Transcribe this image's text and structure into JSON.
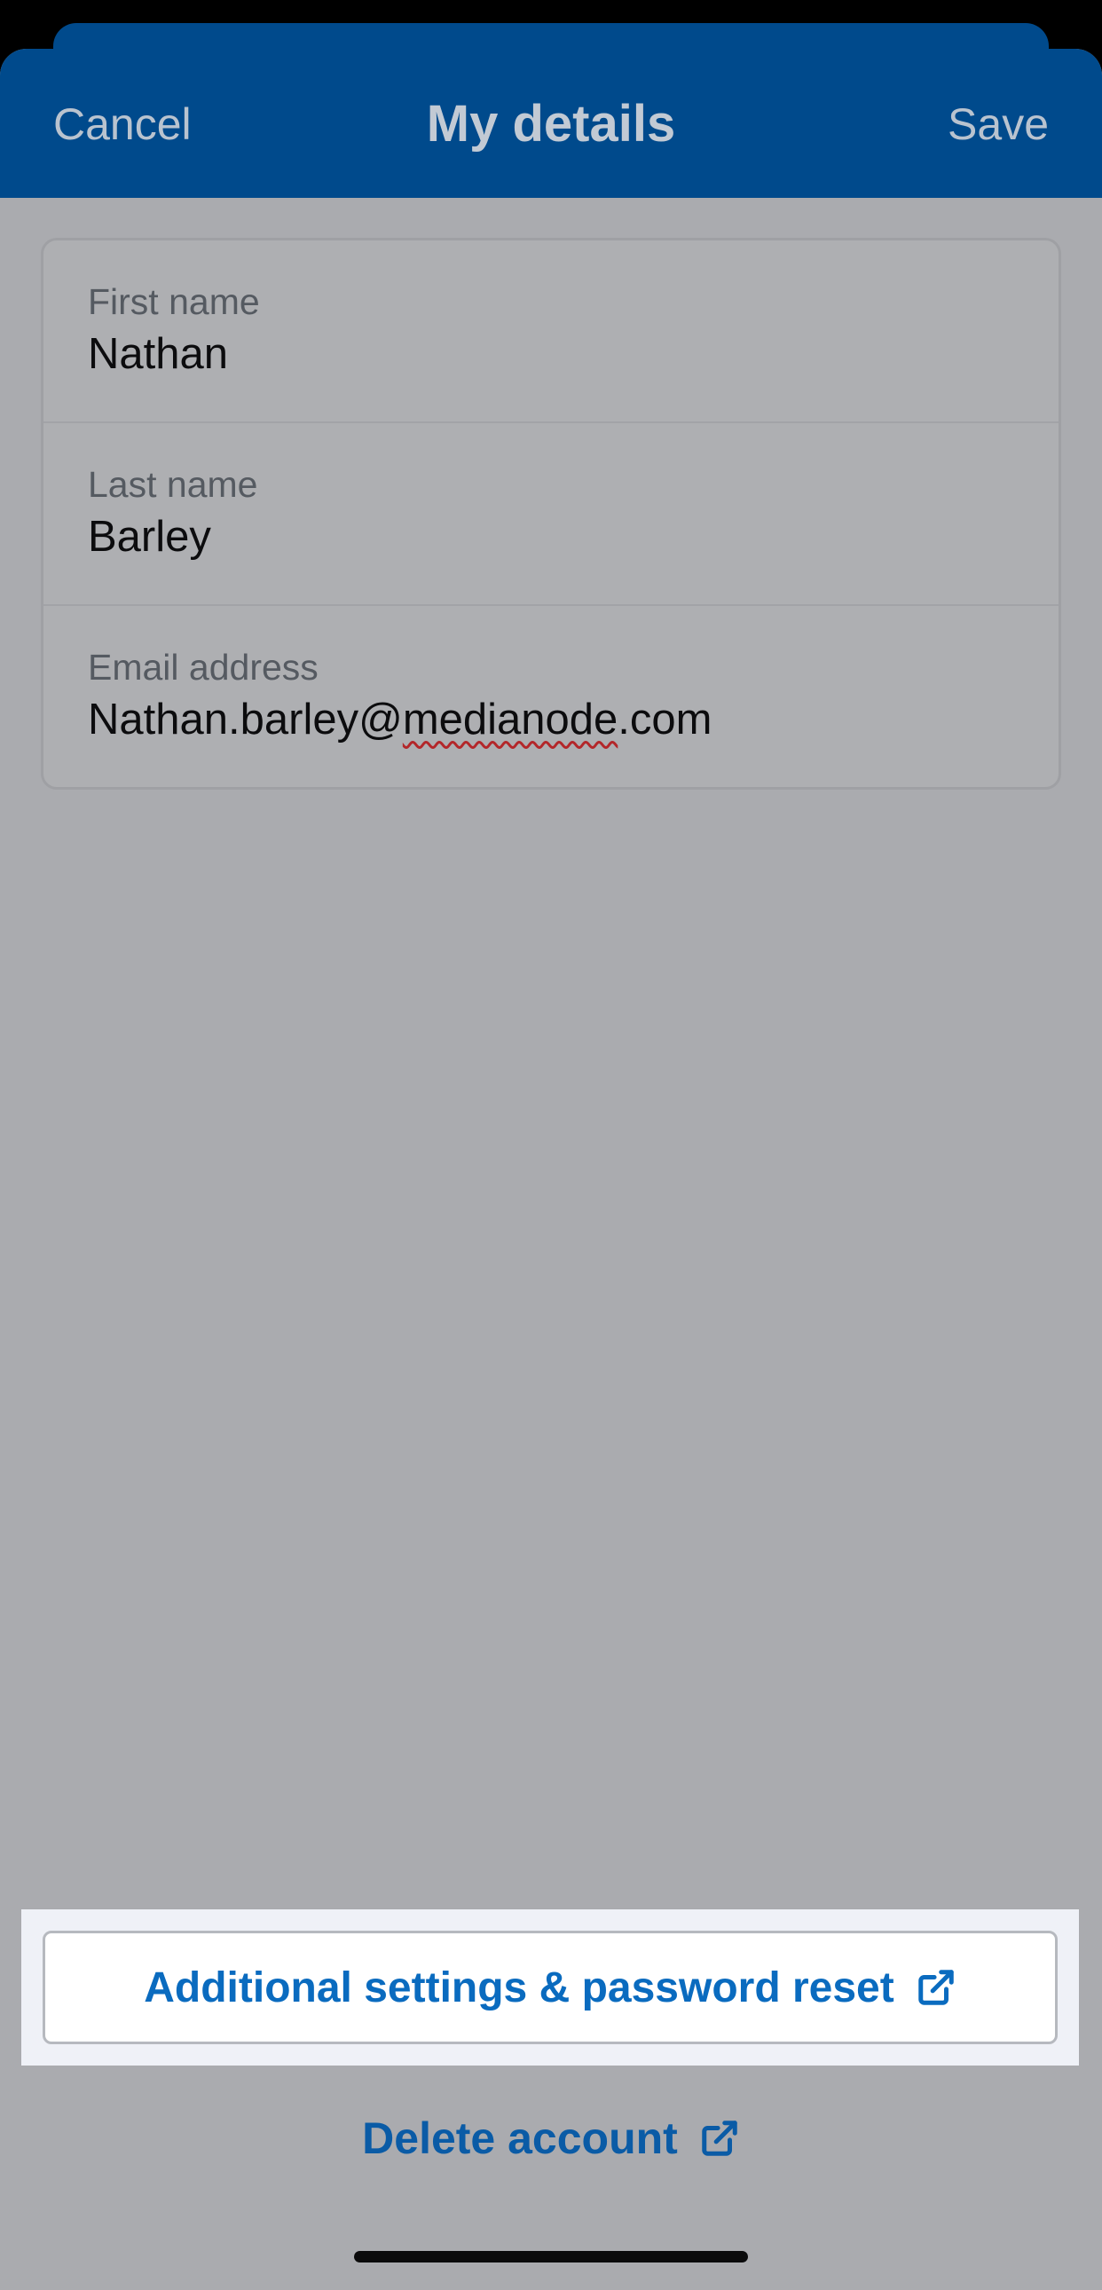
{
  "navbar": {
    "cancel_label": "Cancel",
    "title": "My details",
    "save_label": "Save"
  },
  "form": {
    "fields": [
      {
        "label": "First name",
        "value": "Nathan"
      },
      {
        "label": "Last name",
        "value": "Barley"
      },
      {
        "label": "Email address",
        "value": "Nathan.barley@medianode.com",
        "value_parts": {
          "prefix": "Nathan.barley@",
          "misspelled": "medianode",
          "suffix": ".com"
        }
      }
    ]
  },
  "actions": {
    "settings_label": "Additional settings & password reset",
    "delete_label": "Delete account"
  },
  "icons": {
    "external_link": "external-link-icon"
  },
  "colors": {
    "navbar_bg": "#004a8c",
    "link_blue": "#0a6bbf",
    "overlay_gray": "#aaabaf",
    "spellcheck_red": "#b3272a"
  }
}
